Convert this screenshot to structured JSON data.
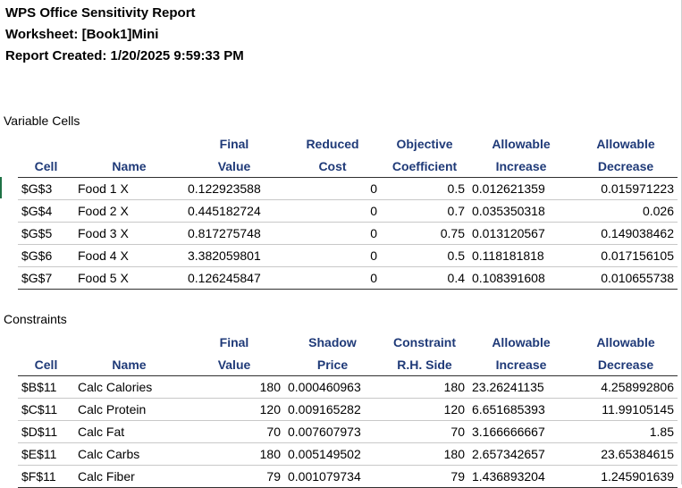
{
  "report": {
    "title": "WPS Office Sensitivity Report",
    "worksheet": "Worksheet: [Book1]Mini",
    "created": "Report Created: 1/20/2025 9:59:33 PM"
  },
  "variable_cells": {
    "section_label": "Variable Cells",
    "headers_top": [
      "",
      "",
      "Final",
      "Reduced",
      "Objective",
      "Allowable",
      "Allowable"
    ],
    "headers_bottom": [
      "Cell",
      "Name",
      "Value",
      "Cost",
      "Coefficient",
      "Increase",
      "Decrease"
    ],
    "rows": [
      [
        "$G$3",
        "Food 1 X",
        "0.122923588",
        "0",
        "0.5",
        "0.012621359",
        "0.015971223"
      ],
      [
        "$G$4",
        "Food 2 X",
        "0.445182724",
        "0",
        "0.7",
        "0.035350318",
        "0.026"
      ],
      [
        "$G$5",
        "Food 3 X",
        "0.817275748",
        "0",
        "0.75",
        "0.013120567",
        "0.149038462"
      ],
      [
        "$G$6",
        "Food 4 X",
        "3.382059801",
        "0",
        "0.5",
        "0.118181818",
        "0.017156105"
      ],
      [
        "$G$7",
        "Food 5 X",
        "0.126245847",
        "0",
        "0.4",
        "0.108391608",
        "0.010655738"
      ]
    ]
  },
  "constraints": {
    "section_label": "Constraints",
    "headers_top": [
      "",
      "",
      "Final",
      "Shadow",
      "Constraint",
      "Allowable",
      "Allowable"
    ],
    "headers_bottom": [
      "Cell",
      "Name",
      "Value",
      "Price",
      "R.H. Side",
      "Increase",
      "Decrease"
    ],
    "rows": [
      [
        "$B$11",
        "Calc Calories",
        "180",
        "0.000460963",
        "180",
        "23.26241135",
        "4.258992806"
      ],
      [
        "$C$11",
        "Calc Protein",
        "120",
        "0.009165282",
        "120",
        "6.651685393",
        "11.99105145"
      ],
      [
        "$D$11",
        "Calc Fat",
        "70",
        "0.007607973",
        "70",
        "3.166666667",
        "1.85"
      ],
      [
        "$E$11",
        "Calc Carbs",
        "180",
        "0.005149502",
        "180",
        "2.657342657",
        "23.65384615"
      ],
      [
        "$F$11",
        "Calc Fiber",
        "79",
        "0.001079734",
        "79",
        "1.436893204",
        "1.245901639"
      ]
    ]
  }
}
